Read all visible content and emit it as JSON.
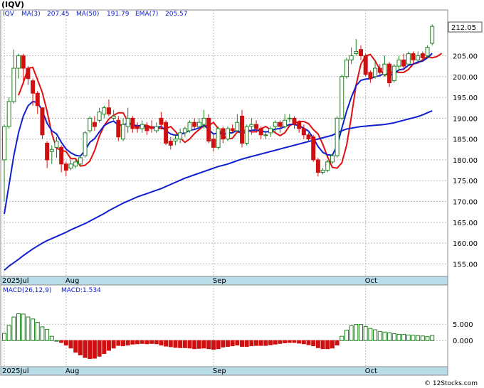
{
  "chart_data": [
    {
      "type": "candlestick",
      "title": "(IQV)",
      "ticker": "IQV",
      "last_price": "212.05",
      "legend": [
        {
          "label": "MA(3)",
          "value": "207.45",
          "color": "#e01010"
        },
        {
          "label": "MA(50)",
          "value": "191.79",
          "color": "#1020d0"
        },
        {
          "label": "EMA(7)",
          "value": "205.57",
          "color": "#1020d0"
        }
      ],
      "ylim": [
        152,
        216
      ],
      "y_ticks": [
        155,
        160,
        165,
        170,
        175,
        180,
        185,
        190,
        195,
        200,
        205
      ],
      "y_tick_labels": [
        "155.00",
        "160.00",
        "165.00",
        "170.00",
        "175.00",
        "180.00",
        "185.00",
        "190.00",
        "195.00",
        "200.00",
        "205.00"
      ],
      "x_labels": [
        {
          "label": "2025Jul",
          "index": 0
        },
        {
          "label": "Aug",
          "index": 13
        },
        {
          "label": "Sep",
          "index": 44
        },
        {
          "label": "Oct",
          "index": 76
        }
      ],
      "candles": [
        [
          180.0,
          188.0,
          170.0,
          188.5
        ],
        [
          188.0,
          194.0,
          187.5,
          195.0
        ],
        [
          194.0,
          202.0,
          193.5,
          206.5
        ],
        [
          202.0,
          205.0,
          199.5,
          205.5
        ],
        [
          205.0,
          202.0,
          199.0,
          205.5
        ],
        [
          202.0,
          199.5,
          198.0,
          202.5
        ],
        [
          199.0,
          196.0,
          193.0,
          199.5
        ],
        [
          196.0,
          193.0,
          191.0,
          196.5
        ],
        [
          192.5,
          186.0,
          185.0,
          192.5
        ],
        [
          184.0,
          180.0,
          178.0,
          184.5
        ],
        [
          182.0,
          182.5,
          179.0,
          183.5
        ],
        [
          183.0,
          184.5,
          180.5,
          185.5
        ],
        [
          183.0,
          179.0,
          177.0,
          183.5
        ],
        [
          179.0,
          177.5,
          176.0,
          179.5
        ],
        [
          178.0,
          179.0,
          177.5,
          180.0
        ],
        [
          178.5,
          179.5,
          178.0,
          180.0
        ],
        [
          179.0,
          180.5,
          178.5,
          181.0
        ],
        [
          181.0,
          186.5,
          180.5,
          187.0
        ],
        [
          187.0,
          190.0,
          186.5,
          190.5
        ],
        [
          189.0,
          188.0,
          187.0,
          190.5
        ],
        [
          189.5,
          191.5,
          189.0,
          192.5
        ],
        [
          191.0,
          192.5,
          190.0,
          193.0
        ],
        [
          192.5,
          191.0,
          190.5,
          194.5
        ],
        [
          190.0,
          190.5,
          189.5,
          192.0
        ],
        [
          189.5,
          185.5,
          184.5,
          190.5
        ],
        [
          185.0,
          188.5,
          184.5,
          190.0
        ],
        [
          188.0,
          190.0,
          186.5,
          192.5
        ],
        [
          190.0,
          187.5,
          186.5,
          190.5
        ],
        [
          188.0,
          187.5,
          186.5,
          189.0
        ],
        [
          187.5,
          188.5,
          186.5,
          189.5
        ],
        [
          188.0,
          187.0,
          186.0,
          189.0
        ],
        [
          188.0,
          187.5,
          186.5,
          189.5
        ],
        [
          187.0,
          188.0,
          186.5,
          189.0
        ],
        [
          190.0,
          188.5,
          187.5,
          191.5
        ],
        [
          189.0,
          184.0,
          183.5,
          189.5
        ],
        [
          184.5,
          183.5,
          182.5,
          185.5
        ],
        [
          184.5,
          185.0,
          183.5,
          186.0
        ],
        [
          185.0,
          186.5,
          184.0,
          187.5
        ],
        [
          186.5,
          187.5,
          185.5,
          188.0
        ],
        [
          187.0,
          189.0,
          186.5,
          189.5
        ],
        [
          189.0,
          188.0,
          187.5,
          190.0
        ],
        [
          188.0,
          189.0,
          187.5,
          190.0
        ],
        [
          188.5,
          190.0,
          187.5,
          192.0
        ],
        [
          190.0,
          184.5,
          184.0,
          191.0
        ],
        [
          185.0,
          183.0,
          182.0,
          186.0
        ],
        [
          183.0,
          187.5,
          182.5,
          188.0
        ],
        [
          187.5,
          185.0,
          184.0,
          188.0
        ],
        [
          185.0,
          187.5,
          184.5,
          188.0
        ],
        [
          187.5,
          187.0,
          186.5,
          188.5
        ],
        [
          187.0,
          189.0,
          186.5,
          191.0
        ],
        [
          190.5,
          184.0,
          183.0,
          192.0
        ],
        [
          184.0,
          188.0,
          183.5,
          188.5
        ],
        [
          188.0,
          188.5,
          186.0,
          190.0
        ],
        [
          188.5,
          187.5,
          186.5,
          189.5
        ],
        [
          187.5,
          186.0,
          185.0,
          188.0
        ],
        [
          186.0,
          186.0,
          185.0,
          187.0
        ],
        [
          186.5,
          187.5,
          185.5,
          188.0
        ],
        [
          188.0,
          189.0,
          186.5,
          189.5
        ],
        [
          189.0,
          188.0,
          186.5,
          189.5
        ],
        [
          188.0,
          189.5,
          187.5,
          191.0
        ],
        [
          190.0,
          190.0,
          189.0,
          191.0
        ],
        [
          190.0,
          188.5,
          187.5,
          190.5
        ],
        [
          189.0,
          187.5,
          186.5,
          189.5
        ],
        [
          187.5,
          186.0,
          185.0,
          188.5
        ],
        [
          186.0,
          185.0,
          184.5,
          186.5
        ],
        [
          185.5,
          180.0,
          179.5,
          186.0
        ],
        [
          180.0,
          177.0,
          176.0,
          180.5
        ],
        [
          177.0,
          177.5,
          176.5,
          178.0
        ],
        [
          177.5,
          179.5,
          177.0,
          180.0
        ],
        [
          179.5,
          181.0,
          179.0,
          181.5
        ],
        [
          181.0,
          190.0,
          180.5,
          190.5
        ],
        [
          190.0,
          200.0,
          189.5,
          200.5
        ],
        [
          200.0,
          204.0,
          199.5,
          204.5
        ],
        [
          204.0,
          205.0,
          203.0,
          207.0
        ],
        [
          205.5,
          206.0,
          205.0,
          209.0
        ],
        [
          206.5,
          205.0,
          204.0,
          207.5
        ],
        [
          205.0,
          200.5,
          200.0,
          205.5
        ],
        [
          201.0,
          199.5,
          198.5,
          201.5
        ],
        [
          200.0,
          202.0,
          199.5,
          204.0
        ],
        [
          202.0,
          201.0,
          200.0,
          203.0
        ],
        [
          200.5,
          203.0,
          200.0,
          205.0
        ],
        [
          203.0,
          198.5,
          197.5,
          203.5
        ],
        [
          199.0,
          202.5,
          198.5,
          203.0
        ],
        [
          202.5,
          204.0,
          201.5,
          205.0
        ],
        [
          204.0,
          202.5,
          201.5,
          205.5
        ],
        [
          203.0,
          205.5,
          202.5,
          206.0
        ],
        [
          205.5,
          204.0,
          203.0,
          206.0
        ],
        [
          204.0,
          205.0,
          203.5,
          206.0
        ],
        [
          205.5,
          204.5,
          203.5,
          206.0
        ],
        [
          205.0,
          207.0,
          204.5,
          207.5
        ],
        [
          208.0,
          212.05,
          207.5,
          212.5
        ]
      ],
      "series": [
        {
          "name": "MA(3)",
          "color": "#e01010",
          "start": 3,
          "values": [
            195.5,
            198.5,
            202.0,
            202.2,
            199.2,
            196.2,
            191.7,
            186.3,
            182.8,
            182.3,
            182.0,
            180.3,
            180.3,
            178.5,
            178.7,
            179.7,
            182.2,
            185.7,
            188.2,
            189.8,
            190.7,
            191.3,
            191.3,
            189.2,
            188.2,
            188.0,
            188.3,
            188.3,
            187.8,
            187.7,
            187.5,
            187.5,
            188.0,
            186.8,
            185.3,
            184.2,
            185.0,
            186.3,
            187.3,
            188.2,
            188.2,
            189.0,
            187.5,
            185.8,
            185.0,
            185.2,
            186.7,
            186.5,
            187.5,
            186.7,
            186.8,
            187.5,
            188.0,
            187.3,
            186.5,
            185.8,
            186.5,
            188.2,
            188.8,
            189.2,
            189.2,
            188.7,
            187.3,
            186.2,
            183.7,
            180.7,
            178.2,
            178.0,
            179.3,
            183.5,
            190.3,
            198.0,
            203.0,
            205.0,
            205.3,
            203.8,
            201.7,
            200.3,
            200.8,
            201.2,
            201.0,
            201.0,
            201.7,
            203.0,
            203.3,
            204.0,
            204.8,
            204.5,
            204.8,
            205.57
          ]
        },
        {
          "name": "EMA(7)",
          "color": "#1020d0",
          "start": 0,
          "values": [
            167.0,
            174.0,
            181.0,
            186.5,
            190.5,
            193.0,
            194.0,
            193.8,
            191.8,
            188.8,
            187.0,
            186.2,
            184.2,
            182.6,
            181.7,
            181.1,
            180.9,
            182.3,
            184.2,
            185.1,
            186.7,
            188.2,
            188.9,
            189.3,
            188.3,
            188.4,
            188.8,
            188.4,
            188.2,
            188.2,
            187.9,
            187.8,
            187.8,
            188.0,
            187.0,
            186.2,
            185.9,
            186.1,
            186.5,
            187.1,
            187.3,
            187.7,
            188.3,
            187.3,
            186.2,
            186.5,
            186.1,
            186.4,
            186.5,
            187.1,
            186.3,
            186.7,
            187.1,
            187.2,
            186.9,
            186.7,
            186.9,
            187.4,
            187.5,
            188.0,
            188.5,
            188.5,
            188.2,
            187.6,
            186.9,
            185.2,
            183.2,
            181.8,
            181.2,
            181.1,
            183.4,
            187.6,
            191.7,
            195.0,
            197.8,
            199.1,
            199.4,
            199.5,
            200.0,
            200.2,
            200.8,
            200.2,
            200.8,
            201.6,
            201.8,
            202.7,
            203.0,
            203.5,
            203.7,
            204.5,
            205.57
          ]
        },
        {
          "name": "MA(50)",
          "color": "#1020d0",
          "start": 0,
          "values": [
            153.5,
            154.5,
            155.3,
            156.1,
            157.0,
            157.8,
            158.6,
            159.3,
            160.0,
            160.6,
            161.1,
            161.6,
            162.1,
            162.6,
            163.2,
            163.7,
            164.2,
            164.7,
            165.3,
            165.9,
            166.5,
            167.1,
            167.8,
            168.4,
            169.0,
            169.6,
            170.1,
            170.6,
            171.1,
            171.5,
            171.9,
            172.3,
            172.7,
            173.1,
            173.6,
            174.1,
            174.6,
            175.1,
            175.6,
            176.0,
            176.4,
            176.8,
            177.2,
            177.6,
            178.0,
            178.4,
            178.7,
            179.0,
            179.4,
            179.8,
            180.2,
            180.5,
            180.8,
            181.1,
            181.4,
            181.7,
            182.0,
            182.3,
            182.6,
            182.9,
            183.2,
            183.5,
            183.8,
            184.1,
            184.4,
            184.7,
            185.0,
            185.3,
            185.6,
            185.9,
            186.5,
            187.0,
            187.4,
            187.6,
            187.8,
            188.0,
            188.1,
            188.2,
            188.3,
            188.4,
            188.5,
            188.7,
            188.9,
            189.2,
            189.5,
            189.8,
            190.1,
            190.4,
            190.8,
            191.3,
            191.79
          ]
        }
      ]
    },
    {
      "type": "bar",
      "title": "MACD(26,12,9)",
      "label": "MACD:1.534",
      "ylim": [
        -8,
        17
      ],
      "y_ticks": [
        0,
        5
      ],
      "y_tick_labels": [
        "0.000",
        "5.000"
      ],
      "positive_color": "#208020",
      "negative_color": "#d01010",
      "values": [
        2.2,
        4.6,
        7.2,
        8.2,
        8.1,
        7.2,
        6.6,
        5.6,
        4.2,
        3.4,
        1.3,
        0.0,
        -0.6,
        -1.4,
        -2.3,
        -3.6,
        -4.4,
        -5.2,
        -5.5,
        -5.4,
        -4.8,
        -4.0,
        -3.0,
        -2.3,
        -1.5,
        -1.6,
        -1.4,
        -1.1,
        -1.0,
        -0.9,
        -1.0,
        -0.9,
        -1.0,
        -1.4,
        -1.7,
        -1.9,
        -2.1,
        -2.2,
        -2.2,
        -2.3,
        -2.5,
        -2.4,
        -2.3,
        -2.5,
        -2.7,
        -2.5,
        -2.0,
        -1.8,
        -1.6,
        -1.4,
        -1.8,
        -1.8,
        -1.6,
        -1.5,
        -1.5,
        -1.5,
        -1.3,
        -1.1,
        -0.9,
        -0.7,
        -0.6,
        -0.6,
        -0.8,
        -1.0,
        -1.3,
        -1.6,
        -2.2,
        -2.5,
        -2.5,
        -2.3,
        -1.4,
        1.3,
        3.2,
        4.5,
        4.9,
        4.9,
        4.3,
        3.7,
        3.3,
        2.8,
        2.6,
        2.4,
        2.1,
        1.9,
        1.9,
        1.7,
        1.6,
        1.5,
        1.4,
        1.2,
        1.534
      ]
    }
  ],
  "x_labels": [
    "2025Jul",
    "Aug",
    "Sep",
    "Oct"
  ],
  "watermark": "© 12Stocks.com"
}
